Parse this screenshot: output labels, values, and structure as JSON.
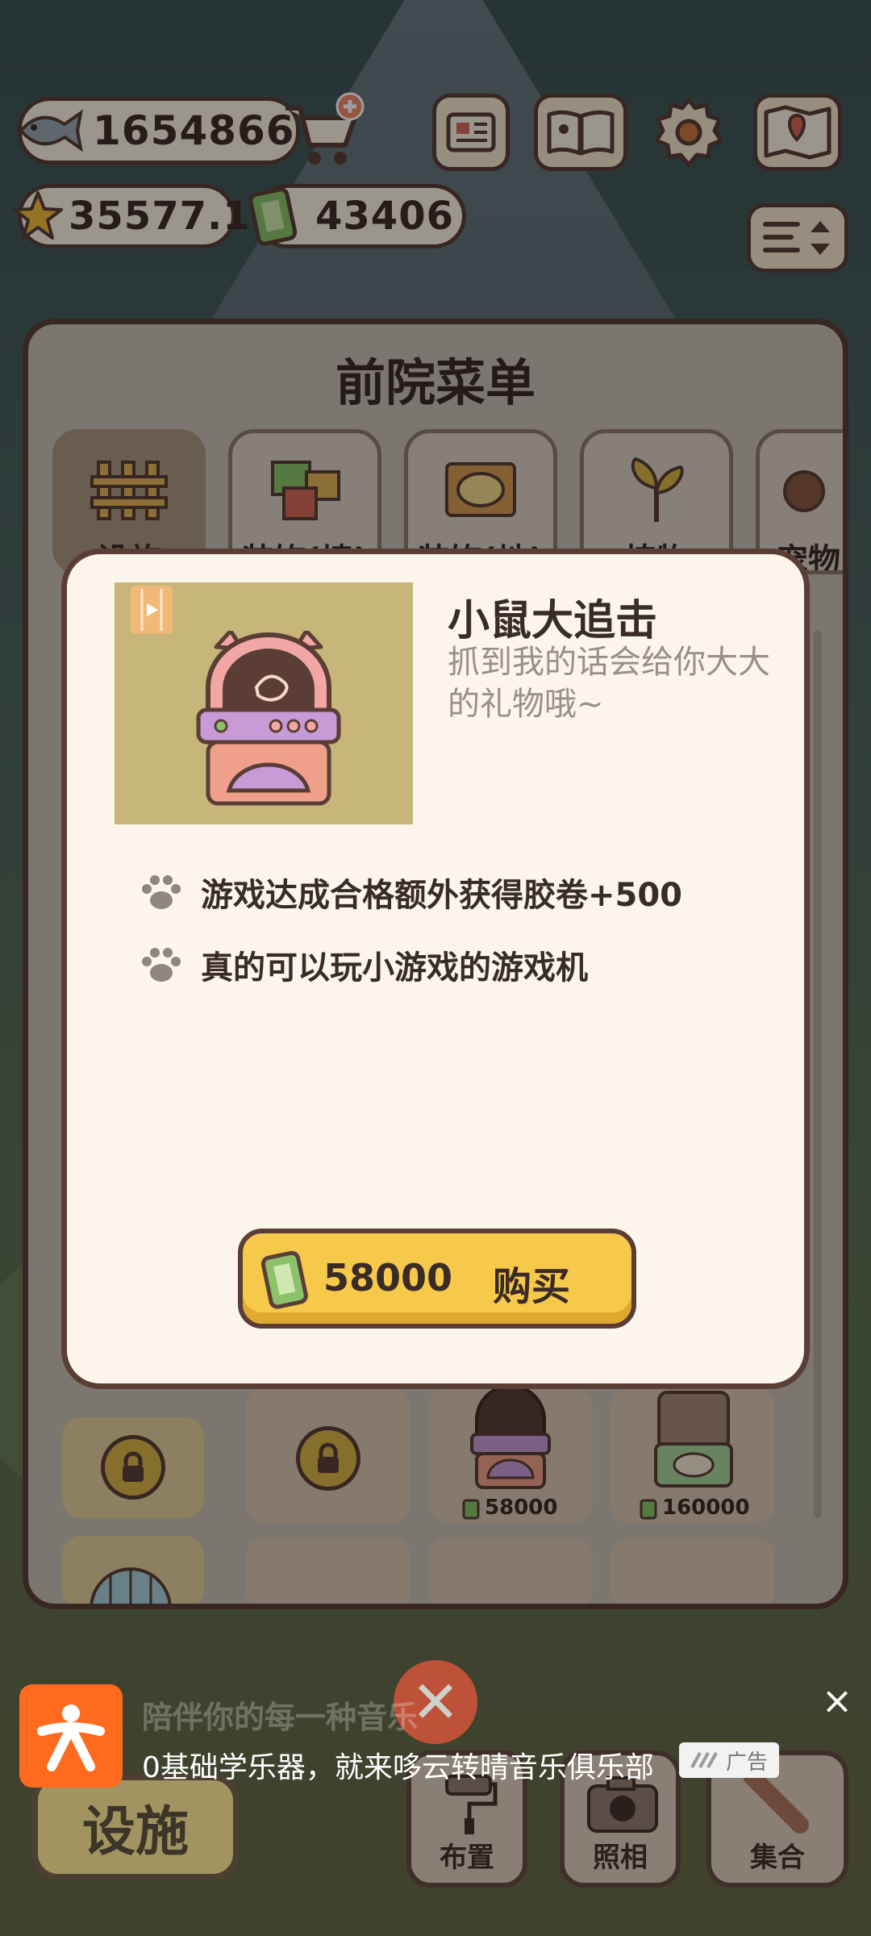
{
  "hud": {
    "fish": "1654866",
    "stars": "35577.1",
    "film": "43406"
  },
  "panel": {
    "title": "前院菜单",
    "tabs": [
      {
        "label": "设施"
      },
      {
        "label": "装饰(墙)"
      },
      {
        "label": "装饰(地)"
      },
      {
        "label": "植物"
      },
      {
        "label": "宠物"
      }
    ],
    "items": [
      {
        "price": "58000"
      },
      {
        "price": "160000"
      }
    ]
  },
  "modal": {
    "title": "小鼠大追击",
    "description": "抓到我的话会给你大大的礼物哦~",
    "features": [
      "游戏达成合格额外获得胶卷+500",
      "真的可以玩小游戏的游戏机"
    ],
    "price": "58000",
    "buy_label": "购买"
  },
  "ad": {
    "title": "陪伴你的每一种音乐",
    "text": "0基础学乐器，就来哆云转晴音乐俱乐部",
    "tag": "广告"
  },
  "nav": {
    "facilities": "设施",
    "layout": "布置",
    "photo": "照相",
    "gather": "集合"
  },
  "colors": {
    "outline": "#5a3e36",
    "cream": "#fbf5ec",
    "button_yellow": "#f6c94a",
    "ad_orange": "#ff6a1e"
  }
}
